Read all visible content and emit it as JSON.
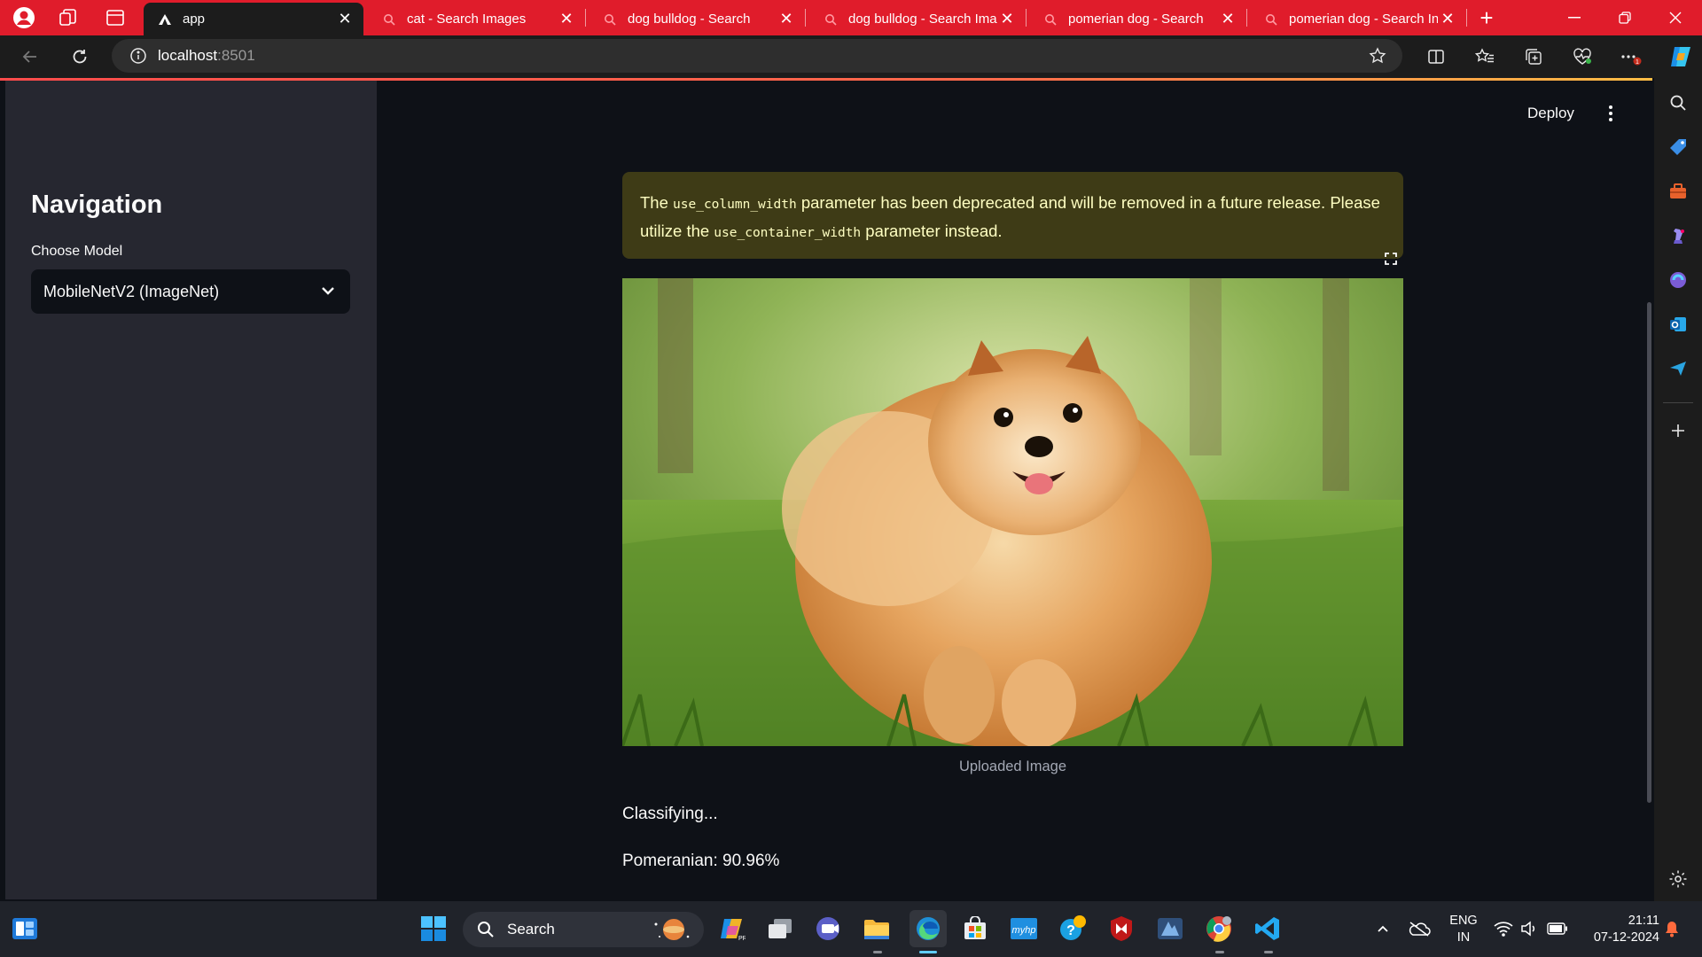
{
  "browser": {
    "tabs": [
      {
        "title": "app",
        "active": true
      },
      {
        "title": "cat - Search Images",
        "active": false
      },
      {
        "title": "dog bulldog - Search",
        "active": false
      },
      {
        "title": "dog bulldog - Search Ima",
        "active": false
      },
      {
        "title": "pomerian dog - Search",
        "active": false
      },
      {
        "title": "pomerian dog - Search In",
        "active": false
      }
    ],
    "new_tab": "+",
    "url_host": "localhost",
    "url_port": ":8501",
    "accent_color": "#e01c2b"
  },
  "sidebar": {
    "title": "Navigation",
    "select_label": "Choose Model",
    "select_value": "MobileNetV2 (ImageNet)"
  },
  "header": {
    "deploy_label": "Deploy"
  },
  "warning": {
    "text_1": "The ",
    "code_1": "use_column_width",
    "text_2": " parameter has been deprecated and will be removed in a future release. Please utilize the ",
    "code_2": "use_container_width",
    "text_3": " parameter instead.",
    "bg_color": "#3e3b16",
    "text_color": "#ffffc2"
  },
  "image": {
    "caption": "Uploaded Image"
  },
  "status": {
    "classifying": "Classifying...",
    "prediction": "Pomeranian: 90.96%"
  },
  "taskbar": {
    "search_label": "Search",
    "lang_line1": "ENG",
    "lang_line2": "IN",
    "time": "21:11",
    "date": "07-12-2024",
    "icons": [
      "widgets-icon",
      "windows-start-icon",
      "copilot-icon",
      "task-view-icon",
      "teams-icon",
      "file-explorer-icon",
      "edge-icon",
      "store-icon",
      "mylp-icon",
      "help-icon",
      "mcafee-icon",
      "vm-icon",
      "chrome-icon",
      "vscode-icon"
    ]
  }
}
